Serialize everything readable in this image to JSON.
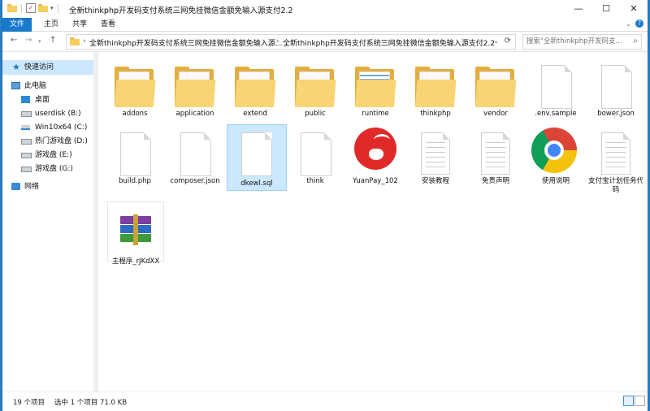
{
  "window": {
    "title": "全新thinkphp开发码支付系统三网免挂微信金额免输入源支付2.2",
    "minimize": "—",
    "maximize": "☐",
    "close": "✕"
  },
  "ribbon": {
    "file_tab": "文件",
    "tabs": [
      "主页",
      "共享",
      "查看"
    ],
    "help": "?"
  },
  "address": {
    "crumbs": [
      "全新thinkphp开发码支付系统三网免挂微信金额免输入源...",
      "全新thinkphp开发码支付系统三网免挂微信金额免输入源支付2.2"
    ],
    "separator": "›",
    "search_placeholder": "搜索\"全新thinkphp开发码支..."
  },
  "sidebar": {
    "items": [
      {
        "label": "快速访问",
        "icon": "star-icon"
      },
      {
        "label": "此电脑",
        "icon": "pc-icon"
      },
      {
        "label": "桌面",
        "icon": "desktop-icon"
      },
      {
        "label": "userdisk (B:)",
        "icon": "drive-icon"
      },
      {
        "label": "Win10x64 (C:)",
        "icon": "windows-drive-icon"
      },
      {
        "label": "热门游戏盘 (D:)",
        "icon": "drive-icon"
      },
      {
        "label": "游戏盘 (E:)",
        "icon": "drive-icon"
      },
      {
        "label": "游戏盘 (G:)",
        "icon": "drive-icon"
      },
      {
        "label": "网络",
        "icon": "network-icon"
      }
    ]
  },
  "files": [
    {
      "name": "addons",
      "type": "folder"
    },
    {
      "name": "application",
      "type": "folder"
    },
    {
      "name": "extend",
      "type": "folder"
    },
    {
      "name": "public",
      "type": "folder"
    },
    {
      "name": "runtime",
      "type": "folder"
    },
    {
      "name": "thinkphp",
      "type": "folder"
    },
    {
      "name": "vendor",
      "type": "folder"
    },
    {
      "name": ".env.sample",
      "type": "file"
    },
    {
      "name": "bower.json",
      "type": "file"
    },
    {
      "name": "build.php",
      "type": "file"
    },
    {
      "name": "composer.json",
      "type": "file"
    },
    {
      "name": "dkewl.sql",
      "type": "file",
      "selected": true
    },
    {
      "name": "think",
      "type": "file"
    },
    {
      "name": "YuanPay_102",
      "type": "app"
    },
    {
      "name": "安装教程",
      "type": "text"
    },
    {
      "name": "免责声明",
      "type": "text"
    },
    {
      "name": "使用说明",
      "type": "chrome"
    },
    {
      "name": "支付宝计划任务代码",
      "type": "text"
    },
    {
      "name": "主程序_rJKdXX",
      "type": "rar"
    }
  ],
  "status": {
    "count": "19 个项目",
    "selection": "选中 1 个项目  71.0 KB"
  }
}
